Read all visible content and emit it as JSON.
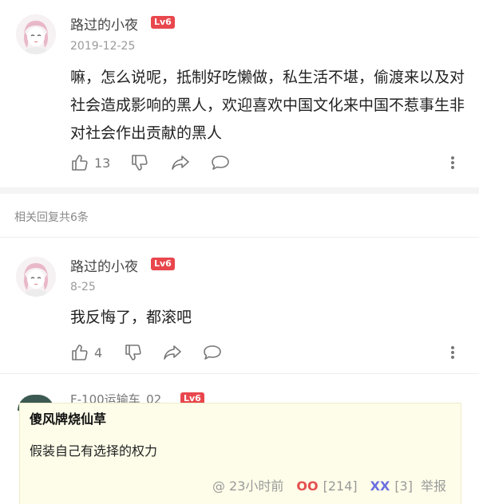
{
  "comment1": {
    "username": "路过的小夜",
    "level": "Lv6",
    "date": "2019-12-25",
    "text": "嘛，怎么说呢，抵制好吃懒做，私生活不堪，偷渡来以及对社会造成影响的黑人，欢迎喜欢中国文化来中国不惹事生非对社会作出贡献的黑人",
    "likes": "13"
  },
  "related_replies": "相关回复共6条",
  "comment2": {
    "username": "路过的小夜",
    "level": "Lv6",
    "date": "8-25",
    "text": "我反悔了，都滚吧",
    "likes": "4"
  },
  "peek": {
    "username": "F-100运输车_02",
    "level": "Lv6"
  },
  "overlay": {
    "title": "傻风牌烧仙草",
    "body": "假装自己有选择的权力",
    "time": "@ 23小时前",
    "oo_label": "OO",
    "oo_count": "[214]",
    "xx_label": "XX",
    "xx_count": "[3]",
    "report": "举报"
  },
  "icons": {
    "like": "thumbs-up-icon",
    "dislike": "thumbs-down-icon",
    "share": "share-icon",
    "reply": "comment-bubble-icon",
    "more": "more-vertical-icon"
  },
  "colors": {
    "level_badge": "#e8474d",
    "oo": "#e45050",
    "xx": "#6b6fe0",
    "overlay_bg": "#fefde9"
  }
}
